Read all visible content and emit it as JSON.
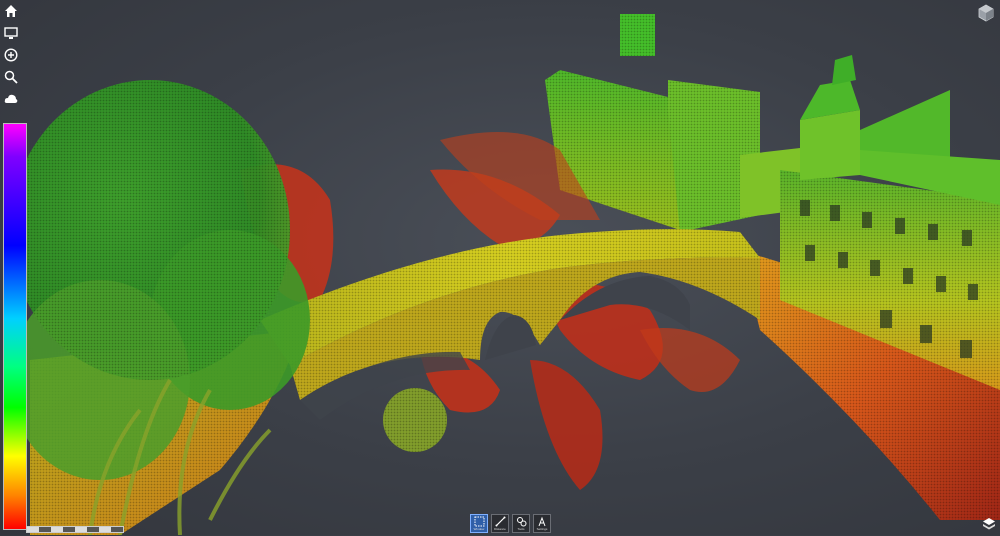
{
  "left_toolbar": [
    {
      "name": "home-icon"
    },
    {
      "name": "monitor-icon"
    },
    {
      "name": "add-circle-icon"
    },
    {
      "name": "search-icon"
    },
    {
      "name": "cloud-icon"
    }
  ],
  "legend": {
    "tick_top": "",
    "tick_mid": "",
    "tick_low": "",
    "tick_bottom": ""
  },
  "scale_bar": {
    "label": ""
  },
  "bottom_toolbar": [
    {
      "name": "select-icon",
      "label": "Window",
      "active": true
    },
    {
      "name": "measure-icon",
      "label": "Distance",
      "active": false
    },
    {
      "name": "tools-icon",
      "label": "Tools",
      "active": false
    },
    {
      "name": "settings-icon",
      "label": "Settings",
      "active": false
    }
  ],
  "colors": {
    "background": "#3b3f47",
    "active_button": "#2f5fa8"
  }
}
